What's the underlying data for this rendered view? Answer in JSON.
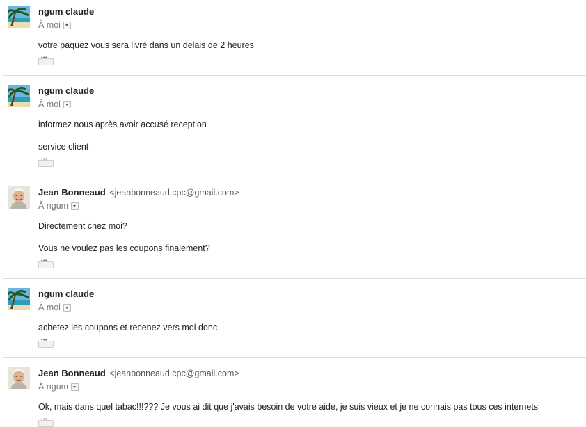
{
  "recipients": {
    "to_me": "À moi",
    "to_ngum": "À ngum"
  },
  "messages": [
    {
      "sender_name": "ngum claude",
      "sender_email": "",
      "recipient": "À moi",
      "avatar": "beach-photo",
      "body": [
        "votre paquez vous sera livré dans un delais de 2 heures"
      ]
    },
    {
      "sender_name": "ngum claude",
      "sender_email": "",
      "recipient": "À moi",
      "avatar": "beach-photo",
      "body": [
        "informez nous après avoir accusé reception",
        "service client"
      ]
    },
    {
      "sender_name": "Jean Bonneaud",
      "sender_email": "<jeanbonneaud.cpc@gmail.com>",
      "recipient": "À ngum",
      "avatar": "man-portrait",
      "body": [
        "Directement chez moi?",
        "Vous ne voulez pas les coupons finalement?"
      ]
    },
    {
      "sender_name": "ngum claude",
      "sender_email": "",
      "recipient": "À moi",
      "avatar": "beach-photo",
      "body": [
        "achetez les coupons et recenez vers moi donc"
      ]
    },
    {
      "sender_name": "Jean Bonneaud",
      "sender_email": "<jeanbonneaud.cpc@gmail.com>",
      "recipient": "À ngum",
      "avatar": "man-portrait",
      "body": [
        "Ok, mais dans quel tabac!!!??? Je vous ai dit que j'avais besoin de votre aide, je suis vieux et je ne connais pas tous ces internets"
      ]
    }
  ]
}
